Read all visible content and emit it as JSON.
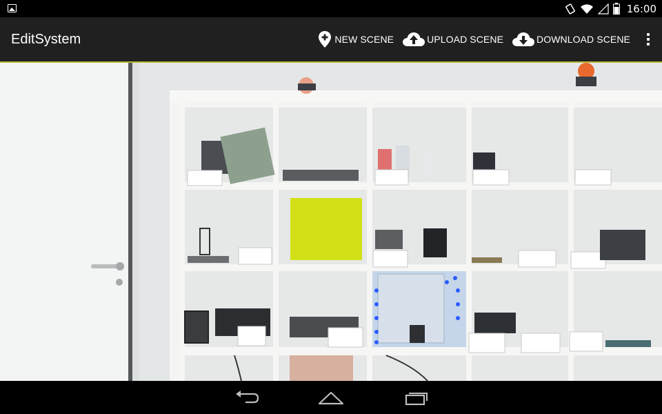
{
  "status_bar": {
    "time": "16:00",
    "icons": [
      "gallery-notification-icon",
      "screen-rotation-icon",
      "wifi-icon",
      "cell-signal-icon",
      "battery-icon"
    ]
  },
  "action_bar": {
    "title": "EditSystem",
    "actions": [
      {
        "label": "NEW SCENE",
        "icon": "add-location-icon"
      },
      {
        "label": "UPLOAD SCENE",
        "icon": "cloud-upload-icon"
      },
      {
        "label": "DOWNLOAD SCENE",
        "icon": "cloud-download-icon"
      }
    ],
    "overflow_icon": "overflow-menu-icon",
    "accent_color": "#b5b835"
  },
  "camera_view": {
    "marker_color": "#d3e017"
  },
  "nav_bar": {
    "buttons": [
      "back-icon",
      "home-icon",
      "recent-apps-icon"
    ]
  }
}
